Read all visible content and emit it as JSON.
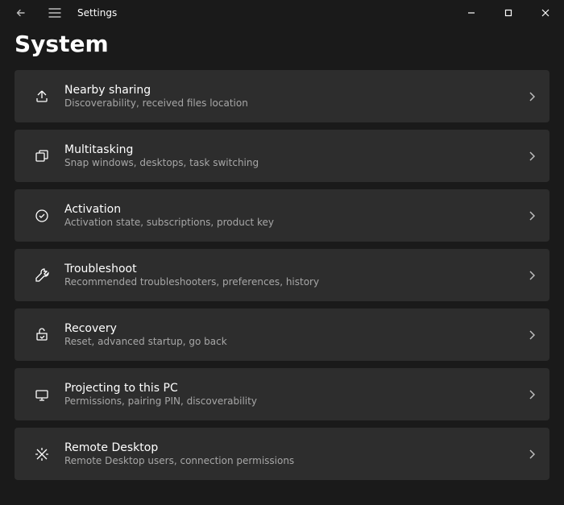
{
  "app_title": "Settings",
  "page_heading": "System",
  "items": [
    {
      "title": "Nearby sharing",
      "subtitle": "Discoverability, received files location"
    },
    {
      "title": "Multitasking",
      "subtitle": "Snap windows, desktops, task switching"
    },
    {
      "title": "Activation",
      "subtitle": "Activation state, subscriptions, product key"
    },
    {
      "title": "Troubleshoot",
      "subtitle": "Recommended troubleshooters, preferences, history"
    },
    {
      "title": "Recovery",
      "subtitle": "Reset, advanced startup, go back"
    },
    {
      "title": "Projecting to this PC",
      "subtitle": "Permissions, pairing PIN, discoverability"
    },
    {
      "title": "Remote Desktop",
      "subtitle": "Remote Desktop users, connection permissions"
    }
  ]
}
